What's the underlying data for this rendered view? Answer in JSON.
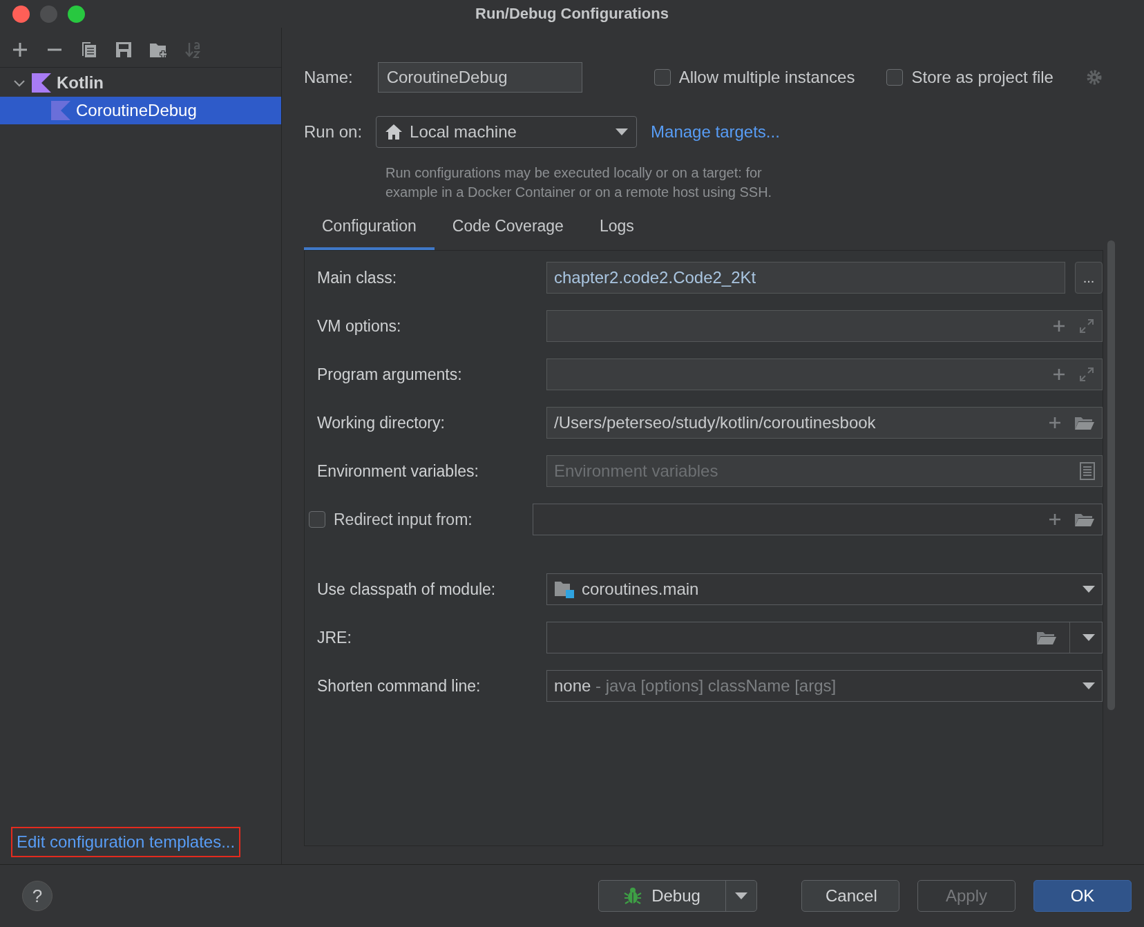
{
  "window": {
    "title": "Run/Debug Configurations"
  },
  "toolbar": [
    {
      "kind": "add",
      "disabled": false
    },
    {
      "kind": "remove",
      "disabled": false
    },
    {
      "kind": "copy",
      "disabled": false
    },
    {
      "kind": "save",
      "disabled": false
    },
    {
      "kind": "folder",
      "disabled": false
    },
    {
      "kind": "sort",
      "disabled": true
    }
  ],
  "tree": [
    {
      "label": "Kotlin",
      "expanded": true,
      "selected": false,
      "children": [
        {
          "label": "CoroutineDebug",
          "selected": true
        }
      ]
    }
  ],
  "templates_link": {
    "label": "Edit configuration templates...",
    "outlined": true
  },
  "name": {
    "label": "Name:",
    "value": "CoroutineDebug"
  },
  "options": [
    {
      "label": "Allow multiple instances",
      "checked": false
    },
    {
      "label": "Store as project file",
      "checked": false
    }
  ],
  "run_on": {
    "label": "Run on:",
    "value": "Local machine",
    "link": "Manage targets...",
    "hint": "Run configurations may be executed locally or on a target: for example in a Docker Container or on a remote host using SSH."
  },
  "tabs": [
    {
      "label": "Configuration",
      "selected": true
    },
    {
      "label": "Code Coverage",
      "selected": false
    },
    {
      "label": "Logs",
      "selected": false
    }
  ],
  "fields": [
    {
      "kind": "class",
      "label": "Main class:",
      "value": "chapter2.code2.Code2_2Kt",
      "button": "..."
    },
    {
      "kind": "expandable",
      "label": "VM options:"
    },
    {
      "kind": "expandable",
      "label": "Program arguments:"
    },
    {
      "kind": "path",
      "label": "Working directory:",
      "value": "/Users/peterseo/study/kotlin/coroutinesbook"
    },
    {
      "kind": "env",
      "label": "Environment variables:",
      "placeholder": "Environment variables"
    },
    {
      "kind": "redirect",
      "label": "Redirect input from:",
      "checked": false
    },
    {
      "kind": "module",
      "label": "Use classpath of module:",
      "value": "coroutines.main"
    },
    {
      "kind": "jre",
      "label": "JRE:"
    },
    {
      "kind": "shorten",
      "label": "Shorten command line:",
      "value": "none",
      "detail": "- java [options] className [args]"
    }
  ],
  "help": "?",
  "buttons": [
    {
      "kind": "split",
      "label": "Debug",
      "disabled": false
    },
    {
      "kind": "normal",
      "label": "Cancel",
      "disabled": false
    },
    {
      "kind": "normal",
      "label": "Apply",
      "disabled": true
    },
    {
      "kind": "default",
      "label": "OK",
      "disabled": false
    }
  ]
}
